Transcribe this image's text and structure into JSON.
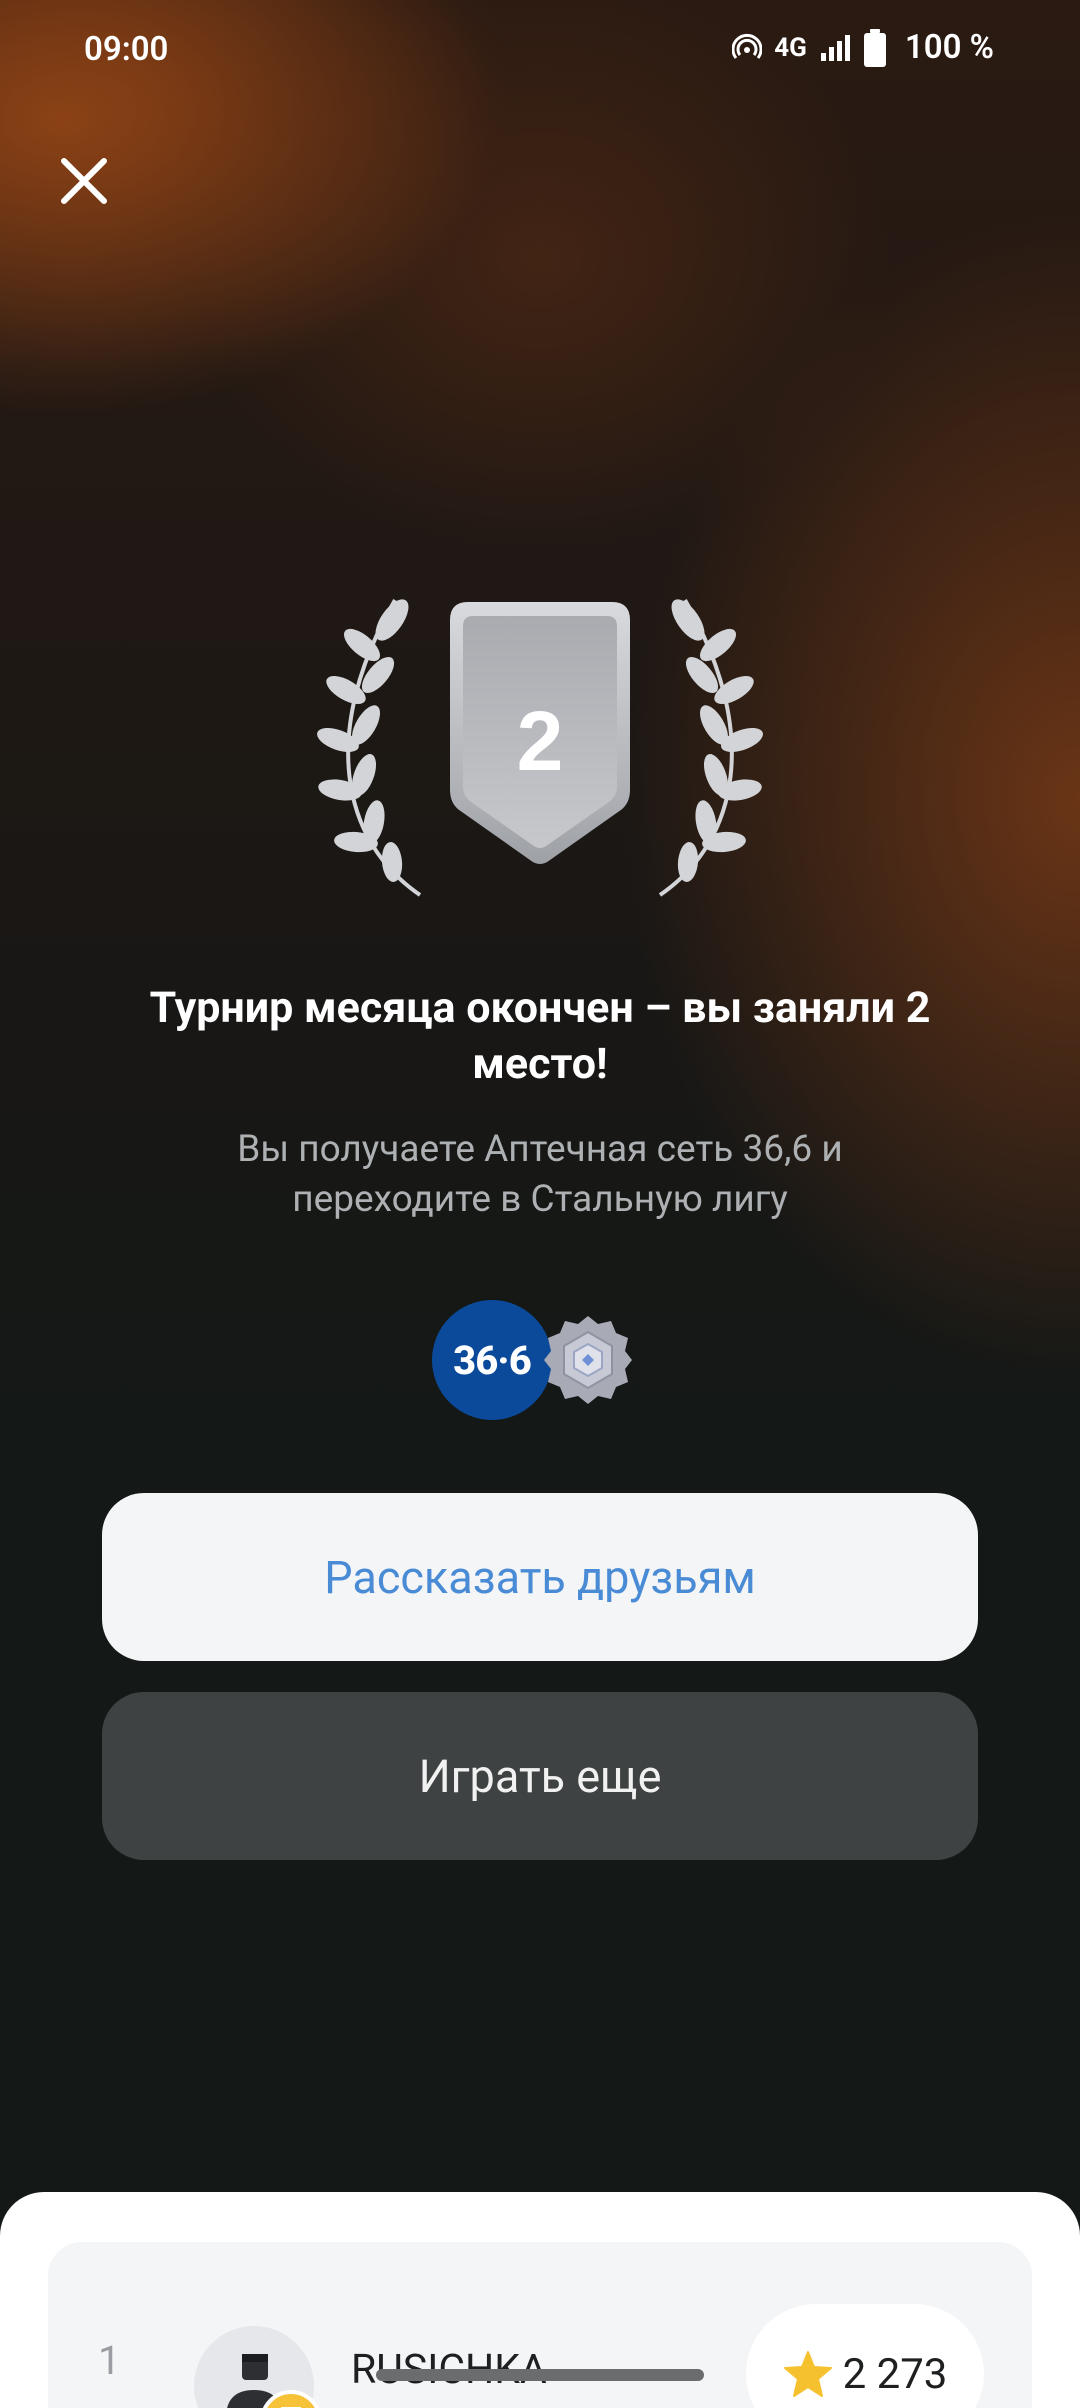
{
  "status_bar": {
    "time": "09:00",
    "network": "4G",
    "battery": "100 %"
  },
  "result": {
    "place": "2",
    "title": "Турнир месяца окончен – вы заняли 2 место!",
    "subtitle": "Вы получаете Аптечная сеть 36,6 и переходите в Стальную лигу"
  },
  "rewards": {
    "partner_logo_text": "36·6",
    "partner_color": "#0b4a9a",
    "league_icon": "steel-league-badge-icon"
  },
  "buttons": {
    "share_label": "Рассказать друзьям",
    "play_label": "Играть еще"
  },
  "leaderboard": {
    "rows": [
      {
        "rank": "1",
        "username": "RUSICHKA",
        "score": "2 273"
      }
    ]
  },
  "colors": {
    "accent_blue": "#4a8bd6",
    "button_dark": "#3f4242",
    "star": "#f5c12e"
  }
}
